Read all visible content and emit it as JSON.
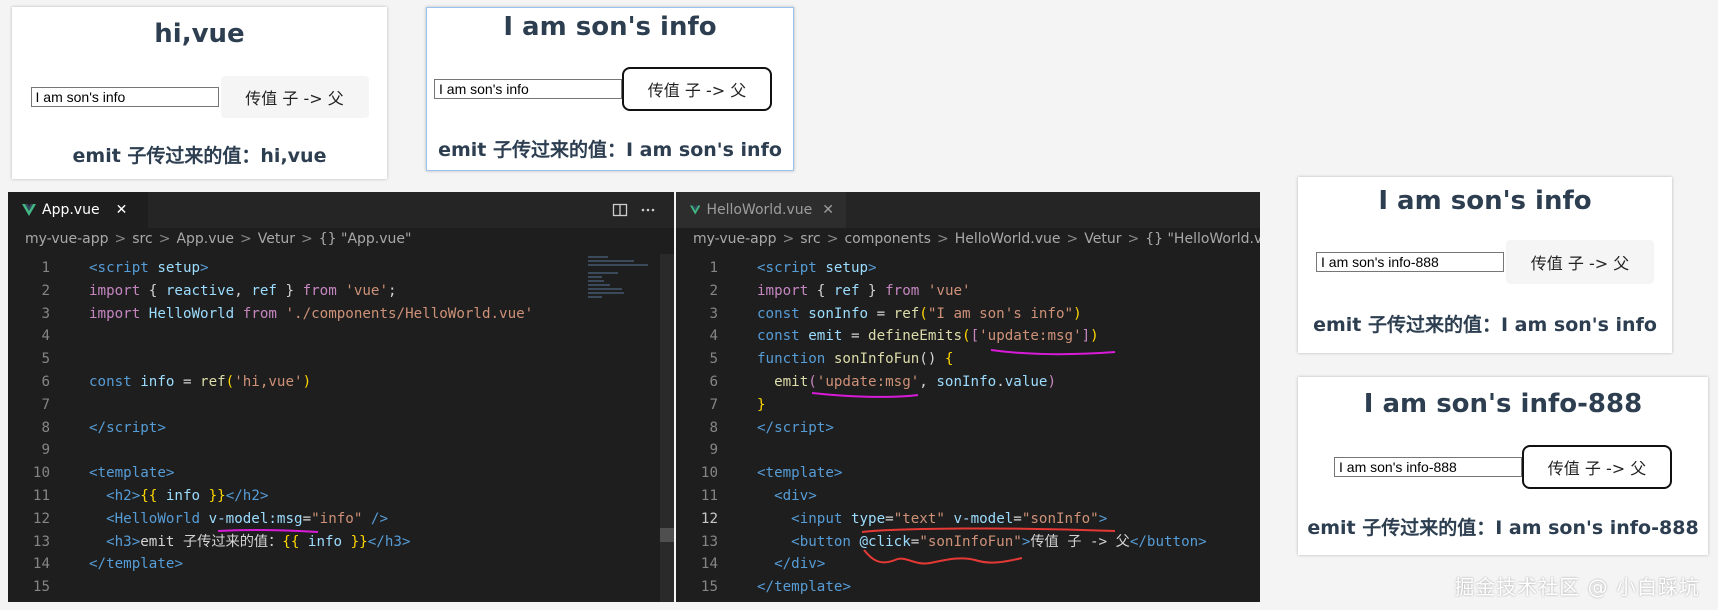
{
  "colors": {
    "vue_green": "#41b883",
    "keyword": "#c586c0",
    "blue": "#569cd6",
    "string": "#ce9178",
    "func": "#dcdcaa",
    "var": "#9cdcfe",
    "tag": "#569cd6",
    "bracket": "#ffd700",
    "markup_pink": "#e040fb",
    "markup_red": "#e53935"
  },
  "demo1": {
    "title": "hi,vue",
    "input_value": "I am son's info",
    "button_label": "传值 子 -> 父",
    "emit_text": "emit 子传过来的值：hi,vue"
  },
  "demo2": {
    "title": "I am son's info",
    "input_value": "I am son's info",
    "button_label": "传值 子 -> 父",
    "emit_text": "emit 子传过来的值：I am son's info"
  },
  "demo3": {
    "title": "I am son's info",
    "input_value": "I am son's info-888",
    "button_label": "传值 子 -> 父",
    "emit_text": "emit 子传过来的值：I am son's info"
  },
  "demo4": {
    "title": "I am son's info-888",
    "input_value": "I am son's info-888",
    "button_label": "传值 子 -> 父",
    "emit_text": "emit 子传过来的值：I am son's info-888"
  },
  "editor_left": {
    "tab_label": "App.vue",
    "tab_close": "✕",
    "split_icon": "split-editor-icon",
    "more_icon": "more-actions-icon",
    "breadcrumbs": [
      "my-vue-app",
      "src",
      "App.vue",
      "Vetur",
      "{} \"App.vue\""
    ],
    "lines": [
      [
        [
          "<",
          "tag"
        ],
        [
          "script",
          "tag"
        ],
        [
          " setup",
          "var"
        ],
        [
          ">",
          "tag"
        ]
      ],
      [
        [
          "import ",
          "keyword"
        ],
        [
          "{ ",
          "default"
        ],
        [
          "reactive",
          "var"
        ],
        [
          ", ",
          "default"
        ],
        [
          "ref",
          "var"
        ],
        [
          " } ",
          "default"
        ],
        [
          "from ",
          "keyword"
        ],
        [
          "'vue'",
          "string"
        ],
        [
          ";",
          "default"
        ]
      ],
      [
        [
          "import ",
          "keyword"
        ],
        [
          "HelloWorld ",
          "var"
        ],
        [
          "from ",
          "keyword"
        ],
        [
          "'./components/HelloWorld.vue'",
          "string"
        ]
      ],
      [],
      [],
      [
        [
          "const ",
          "blue"
        ],
        [
          "info",
          "var"
        ],
        [
          " = ",
          "default"
        ],
        [
          "ref",
          "func"
        ],
        [
          "(",
          "bracket"
        ],
        [
          "'hi,vue'",
          "string"
        ],
        [
          ")",
          "bracket"
        ]
      ],
      [],
      [
        [
          "</",
          "tag"
        ],
        [
          "script",
          "tag"
        ],
        [
          ">",
          "tag"
        ]
      ],
      [],
      [
        [
          "<",
          "tag"
        ],
        [
          "template",
          "tag"
        ],
        [
          ">",
          "tag"
        ]
      ],
      [
        [
          "  <",
          "tag"
        ],
        [
          "h2",
          "tag"
        ],
        [
          ">",
          "tag"
        ],
        [
          "{{ ",
          "bracket"
        ],
        [
          "info",
          "var"
        ],
        [
          " }}",
          "bracket"
        ],
        [
          "</",
          "tag"
        ],
        [
          "h2",
          "tag"
        ],
        [
          ">",
          "tag"
        ]
      ],
      [
        [
          "  <",
          "tag"
        ],
        [
          "HelloWorld ",
          "tag"
        ],
        [
          "v-model:msg",
          "var"
        ],
        [
          "=",
          "default"
        ],
        [
          "\"info\"",
          "string"
        ],
        [
          " />",
          "tag"
        ]
      ],
      [
        [
          "  <",
          "tag"
        ],
        [
          "h3",
          "tag"
        ],
        [
          ">",
          "tag"
        ],
        [
          "emit 子传过来的值：",
          "default"
        ],
        [
          "{{ ",
          "bracket"
        ],
        [
          "info",
          "var"
        ],
        [
          " }}",
          "bracket"
        ],
        [
          "</",
          "tag"
        ],
        [
          "h3",
          "tag"
        ],
        [
          ">",
          "tag"
        ]
      ],
      [
        [
          "</",
          "tag"
        ],
        [
          "template",
          "tag"
        ],
        [
          ">",
          "tag"
        ]
      ],
      []
    ]
  },
  "editor_right": {
    "tab_label": "HelloWorld.vue",
    "tab_close": "✕",
    "breadcrumbs": [
      "my-vue-app",
      "src",
      "components",
      "HelloWorld.vue",
      "Vetur",
      "{} \"HelloWorld.vue\""
    ],
    "current_line": 12,
    "lines": [
      [
        [
          "<",
          "tag"
        ],
        [
          "script",
          "tag"
        ],
        [
          " setup",
          "var"
        ],
        [
          ">",
          "tag"
        ]
      ],
      [
        [
          "import ",
          "keyword"
        ],
        [
          "{ ",
          "default"
        ],
        [
          "ref",
          "var"
        ],
        [
          " } ",
          "default"
        ],
        [
          "from ",
          "keyword"
        ],
        [
          "'vue'",
          "string"
        ]
      ],
      [
        [
          "const ",
          "blue"
        ],
        [
          "sonInfo",
          "var"
        ],
        [
          " = ",
          "default"
        ],
        [
          "ref",
          "func"
        ],
        [
          "(",
          "bracket"
        ],
        [
          "\"I am son's info\"",
          "string"
        ],
        [
          ")",
          "bracket"
        ]
      ],
      [
        [
          "const ",
          "blue"
        ],
        [
          "emit",
          "var"
        ],
        [
          " = ",
          "default"
        ],
        [
          "defineEmits",
          "func"
        ],
        [
          "(",
          "bracket"
        ],
        [
          "[",
          "keyword"
        ],
        [
          "'update:msg'",
          "string"
        ],
        [
          "]",
          "keyword"
        ],
        [
          ")",
          "bracket"
        ]
      ],
      [
        [
          "function ",
          "blue"
        ],
        [
          "sonInfoFun",
          "func"
        ],
        [
          "() ",
          "default"
        ],
        [
          "{",
          "bracket"
        ]
      ],
      [
        [
          "  emit",
          "func"
        ],
        [
          "(",
          "keyword"
        ],
        [
          "'update:msg'",
          "string"
        ],
        [
          ", ",
          "default"
        ],
        [
          "sonInfo",
          "var"
        ],
        [
          ".",
          "default"
        ],
        [
          "value",
          "var"
        ],
        [
          ")",
          "keyword"
        ]
      ],
      [
        [
          "}",
          "bracket"
        ]
      ],
      [
        [
          "</",
          "tag"
        ],
        [
          "script",
          "tag"
        ],
        [
          ">",
          "tag"
        ]
      ],
      [],
      [
        [
          "<",
          "tag"
        ],
        [
          "template",
          "tag"
        ],
        [
          ">",
          "tag"
        ]
      ],
      [
        [
          "  <",
          "tag"
        ],
        [
          "div",
          "tag"
        ],
        [
          ">",
          "tag"
        ]
      ],
      [
        [
          "    <",
          "tag"
        ],
        [
          "input ",
          "tag"
        ],
        [
          "type",
          "var"
        ],
        [
          "=",
          "default"
        ],
        [
          "\"text\"",
          "string"
        ],
        [
          " ",
          "default"
        ],
        [
          "v-model",
          "var"
        ],
        [
          "=",
          "default"
        ],
        [
          "\"sonInfo\"",
          "string"
        ],
        [
          ">",
          "tag"
        ]
      ],
      [
        [
          "    <",
          "tag"
        ],
        [
          "button ",
          "tag"
        ],
        [
          "@click",
          "var"
        ],
        [
          "=",
          "default"
        ],
        [
          "\"sonInfoFun\"",
          "string"
        ],
        [
          ">",
          "tag"
        ],
        [
          "传值 子 -> 父",
          "default"
        ],
        [
          "</",
          "tag"
        ],
        [
          "button",
          "tag"
        ],
        [
          ">",
          "tag"
        ]
      ],
      [
        [
          "  </",
          "tag"
        ],
        [
          "div",
          "tag"
        ],
        [
          ">",
          "tag"
        ]
      ],
      [
        [
          "</",
          "tag"
        ],
        [
          "template",
          "tag"
        ],
        [
          ">",
          "tag"
        ]
      ]
    ]
  },
  "watermark": "掘金技术社区 @ 小白踩坑"
}
